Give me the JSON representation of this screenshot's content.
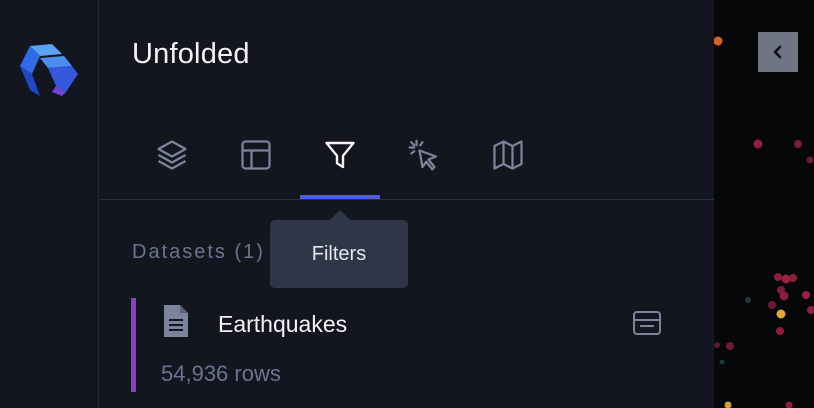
{
  "app": {
    "title": "Unfolded"
  },
  "tabs": [
    {
      "name": "layers",
      "icon": "layers-icon",
      "active": false
    },
    {
      "name": "interactions",
      "icon": "layout-icon",
      "active": false
    },
    {
      "name": "filters",
      "icon": "filter-icon",
      "active": true
    },
    {
      "name": "tooltip",
      "icon": "cursor-click-icon",
      "active": false
    },
    {
      "name": "basemap",
      "icon": "map-icon",
      "active": false
    }
  ],
  "tooltip": {
    "text": "Filters"
  },
  "datasets": {
    "section_label": "Datasets (1)",
    "items": [
      {
        "name": "Earthquakes",
        "rows": "54,936 rows",
        "color": "#8a3fc8"
      }
    ]
  },
  "colors": {
    "background": "#14161f",
    "active_tab": "#4d5fdc",
    "map_background": "#060709"
  }
}
